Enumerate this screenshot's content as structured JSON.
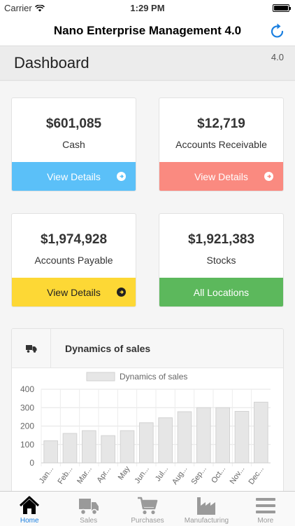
{
  "status_bar": {
    "carrier": "Carrier",
    "time": "1:29 PM"
  },
  "nav": {
    "title": "Nano Enterprise Management 4.0",
    "refresh_icon": "refresh-icon"
  },
  "dashboard": {
    "title": "Dashboard",
    "version": "4.0"
  },
  "cards": [
    {
      "amount": "$601,085",
      "label": "Cash",
      "action": "View Details",
      "color": "#5bc0f8",
      "text_color": "#ffffff"
    },
    {
      "amount": "$12,719",
      "label": "Accounts Receivable",
      "action": "View Details",
      "color": "#fa8a80",
      "text_color": "#ffffff"
    },
    {
      "amount": "$1,974,928",
      "label": "Accounts Payable",
      "action": "View Details",
      "color": "#fdd835",
      "text_color": "#222222"
    },
    {
      "amount": "$1,921,383",
      "label": "Stocks",
      "action": "All Locations",
      "color": "#5cb85c",
      "text_color": "#ffffff"
    }
  ],
  "sales_panel": {
    "title": "Dynamics of sales",
    "icon": "truck-icon"
  },
  "chart_data": {
    "type": "bar",
    "title": "",
    "categories": [
      "Jan...",
      "Feb...",
      "Mar...",
      "Apr...",
      "May",
      "Jun...",
      "Jul...",
      "Aug...",
      "Sep...",
      "Oct...",
      "Nov...",
      "Dec..."
    ],
    "series": [
      {
        "name": "Dynamics of sales",
        "values": [
          120,
          160,
          175,
          148,
          175,
          218,
          245,
          278,
          300,
          300,
          280,
          330
        ]
      }
    ],
    "ylim": [
      0,
      400
    ],
    "yticks": [
      0,
      100,
      200,
      300,
      400
    ],
    "grid": true,
    "legend": "top-center",
    "bar_color": "#e6e6e6",
    "bar_border": "#d2d2d2"
  },
  "tabs": [
    {
      "label": "Home",
      "icon": "home-icon",
      "active": true
    },
    {
      "label": "Sales",
      "icon": "truck-icon",
      "active": false
    },
    {
      "label": "Purchases",
      "icon": "cart-icon",
      "active": false
    },
    {
      "label": "Manufacturing",
      "icon": "factory-icon",
      "active": false
    },
    {
      "label": "More",
      "icon": "menu-icon",
      "active": false
    }
  ],
  "colors": {
    "accent": "#1a7fe0",
    "inactive_tab": "#9a9a9a"
  }
}
